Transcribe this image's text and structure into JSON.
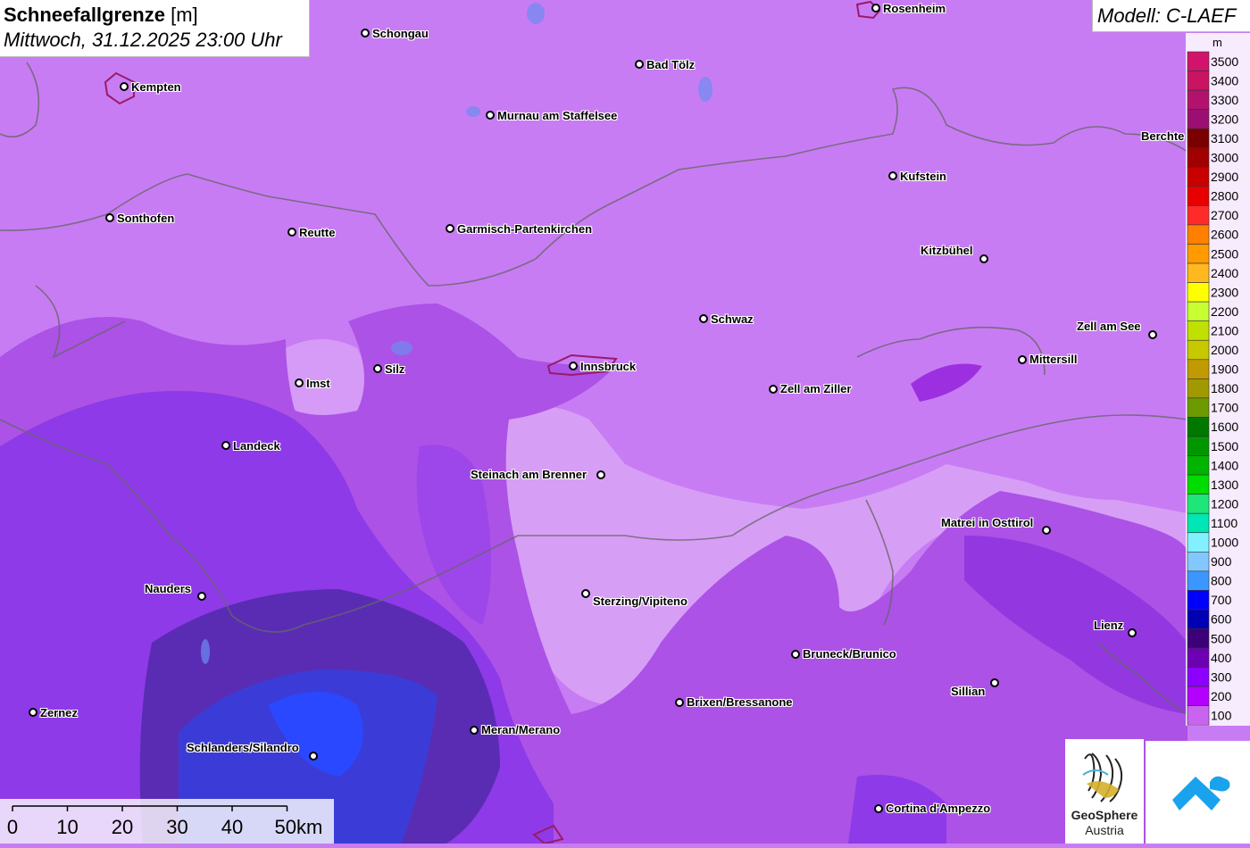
{
  "title": {
    "main": "Schneefallgrenze",
    "unit": "[m]",
    "datetime": "Mittwoch, 31.12.2025 23:00 Uhr"
  },
  "model": "Modell: C-LAEF",
  "legend": {
    "unit": "m",
    "levels": [
      {
        "label": "3500",
        "color": "#d2136b"
      },
      {
        "label": "3400",
        "color": "#c81462"
      },
      {
        "label": "3300",
        "color": "#b2126e"
      },
      {
        "label": "3200",
        "color": "#9b0f72"
      },
      {
        "label": "3100",
        "color": "#7a0000"
      },
      {
        "label": "3000",
        "color": "#a00000"
      },
      {
        "label": "2900",
        "color": "#c80000"
      },
      {
        "label": "2800",
        "color": "#e80000"
      },
      {
        "label": "2700",
        "color": "#ff2a2a"
      },
      {
        "label": "2600",
        "color": "#ff8000"
      },
      {
        "label": "2500",
        "color": "#ff9a00"
      },
      {
        "label": "2400",
        "color": "#ffb81e"
      },
      {
        "label": "2300",
        "color": "#ffff00"
      },
      {
        "label": "2200",
        "color": "#c8ff32"
      },
      {
        "label": "2100",
        "color": "#c0e000"
      },
      {
        "label": "2000",
        "color": "#c8c800"
      },
      {
        "label": "1900",
        "color": "#c09a00"
      },
      {
        "label": "1800",
        "color": "#a09a00"
      },
      {
        "label": "1700",
        "color": "#6c9a00"
      },
      {
        "label": "1600",
        "color": "#007800"
      },
      {
        "label": "1500",
        "color": "#009600"
      },
      {
        "label": "1400",
        "color": "#00b400"
      },
      {
        "label": "1300",
        "color": "#00dc00"
      },
      {
        "label": "1200",
        "color": "#1ee678"
      },
      {
        "label": "1100",
        "color": "#00e6b4"
      },
      {
        "label": "1000",
        "color": "#82f0ff"
      },
      {
        "label": "900",
        "color": "#82c8ff"
      },
      {
        "label": "800",
        "color": "#3c96ff"
      },
      {
        "label": "700",
        "color": "#0000ff"
      },
      {
        "label": "600",
        "color": "#0000b4"
      },
      {
        "label": "500",
        "color": "#3c0078"
      },
      {
        "label": "400",
        "color": "#6e00b4"
      },
      {
        "label": "300",
        "color": "#8c00ff"
      },
      {
        "label": "200",
        "color": "#b400ff"
      },
      {
        "label": "100",
        "color": "#c864f0"
      }
    ]
  },
  "scale": {
    "ticks": [
      "0",
      "10",
      "20",
      "30",
      "40"
    ],
    "last": "50km"
  },
  "logos": {
    "geosphere_line1": "GeoSphere",
    "geosphere_line2": "Austria"
  },
  "cities": [
    {
      "name": "Rosenheim"
    },
    {
      "name": "Schongau"
    },
    {
      "name": "Bad Tölz"
    },
    {
      "name": "Kempten"
    },
    {
      "name": "Murnau am Staffelsee"
    },
    {
      "name": "Berchte"
    },
    {
      "name": "Kufstein"
    },
    {
      "name": "Sonthofen"
    },
    {
      "name": "Reutte"
    },
    {
      "name": "Garmisch-Partenkirchen"
    },
    {
      "name": "Kitzbühel"
    },
    {
      "name": "Schwaz"
    },
    {
      "name": "Zell am See"
    },
    {
      "name": "Mittersill"
    },
    {
      "name": "Silz"
    },
    {
      "name": "Imst"
    },
    {
      "name": "Innsbruck"
    },
    {
      "name": "Zell am Ziller"
    },
    {
      "name": "Landeck"
    },
    {
      "name": "Steinach am Brenner"
    },
    {
      "name": "Matrei in Osttirol"
    },
    {
      "name": "Nauders"
    },
    {
      "name": "Sterzing/Vipiteno"
    },
    {
      "name": "Lienz"
    },
    {
      "name": "Bruneck/Brunico"
    },
    {
      "name": "Sillian"
    },
    {
      "name": "Brixen/Bressanone"
    },
    {
      "name": "Zernez"
    },
    {
      "name": "Meran/Merano"
    },
    {
      "name": "Schlanders/Silandro"
    },
    {
      "name": "Cortina d'Ampezzo"
    }
  ]
}
